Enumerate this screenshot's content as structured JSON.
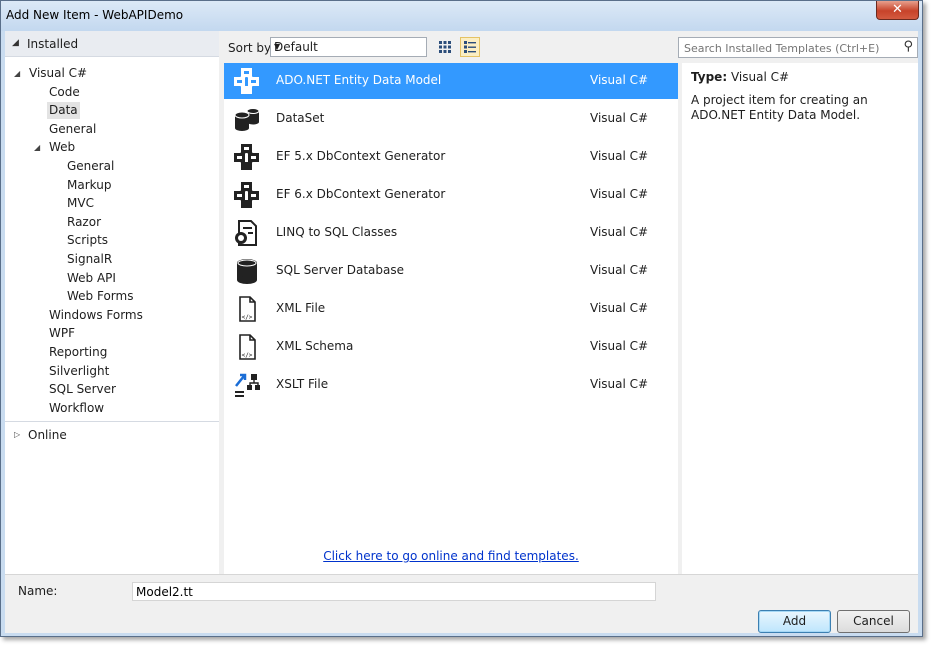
{
  "window": {
    "title": "Add New Item - WebAPIDemo",
    "close_label": "✕"
  },
  "left": {
    "installed_label": "Installed",
    "online_label": "Online",
    "tree": [
      {
        "label": "Visual C#",
        "indent": 0,
        "expanded": true
      },
      {
        "label": "Code",
        "indent": 1
      },
      {
        "label": "Data",
        "indent": 1,
        "selected": true
      },
      {
        "label": "General",
        "indent": 1
      },
      {
        "label": "Web",
        "indent": 1,
        "expanded": true
      },
      {
        "label": "General",
        "indent": 2
      },
      {
        "label": "Markup",
        "indent": 2
      },
      {
        "label": "MVC",
        "indent": 2
      },
      {
        "label": "Razor",
        "indent": 2
      },
      {
        "label": "Scripts",
        "indent": 2
      },
      {
        "label": "SignalR",
        "indent": 2
      },
      {
        "label": "Web API",
        "indent": 2
      },
      {
        "label": "Web Forms",
        "indent": 2
      },
      {
        "label": "Windows Forms",
        "indent": 1
      },
      {
        "label": "WPF",
        "indent": 1
      },
      {
        "label": "Reporting",
        "indent": 1
      },
      {
        "label": "Silverlight",
        "indent": 1
      },
      {
        "label": "SQL Server",
        "indent": 1
      },
      {
        "label": "Workflow",
        "indent": 1
      }
    ]
  },
  "toolbar": {
    "sort_label": "Sort by:",
    "sort_value": "Default",
    "search_placeholder": "Search Installed Templates (Ctrl+E)"
  },
  "templates": [
    {
      "name": "ADO.NET Entity Data Model",
      "lang": "Visual C#",
      "icon": "entity-model-icon",
      "selected": true
    },
    {
      "name": "DataSet",
      "lang": "Visual C#",
      "icon": "dataset-icon"
    },
    {
      "name": "EF 5.x DbContext Generator",
      "lang": "Visual C#",
      "icon": "dbcontext-generator-icon"
    },
    {
      "name": "EF 6.x DbContext Generator",
      "lang": "Visual C#",
      "icon": "dbcontext-generator-icon"
    },
    {
      "name": "LINQ to SQL Classes",
      "lang": "Visual C#",
      "icon": "linq-to-sql-icon"
    },
    {
      "name": "SQL Server Database",
      "lang": "Visual C#",
      "icon": "database-icon"
    },
    {
      "name": "XML File",
      "lang": "Visual C#",
      "icon": "xml-file-icon"
    },
    {
      "name": "XML Schema",
      "lang": "Visual C#",
      "icon": "xml-schema-icon"
    },
    {
      "name": "XSLT File",
      "lang": "Visual C#",
      "icon": "xslt-file-icon"
    }
  ],
  "online_link": "Click here to go online and find templates.",
  "info": {
    "type_label": "Type:",
    "type_value": "Visual C#",
    "description": "A project item for creating an ADO.NET Entity Data Model."
  },
  "bottom": {
    "name_label": "Name:",
    "name_value": "Model2.tt",
    "add_label": "Add",
    "cancel_label": "Cancel"
  },
  "colors": {
    "selection": "#3399ff",
    "link": "#0033cc",
    "frame": "#c9dcf0"
  }
}
